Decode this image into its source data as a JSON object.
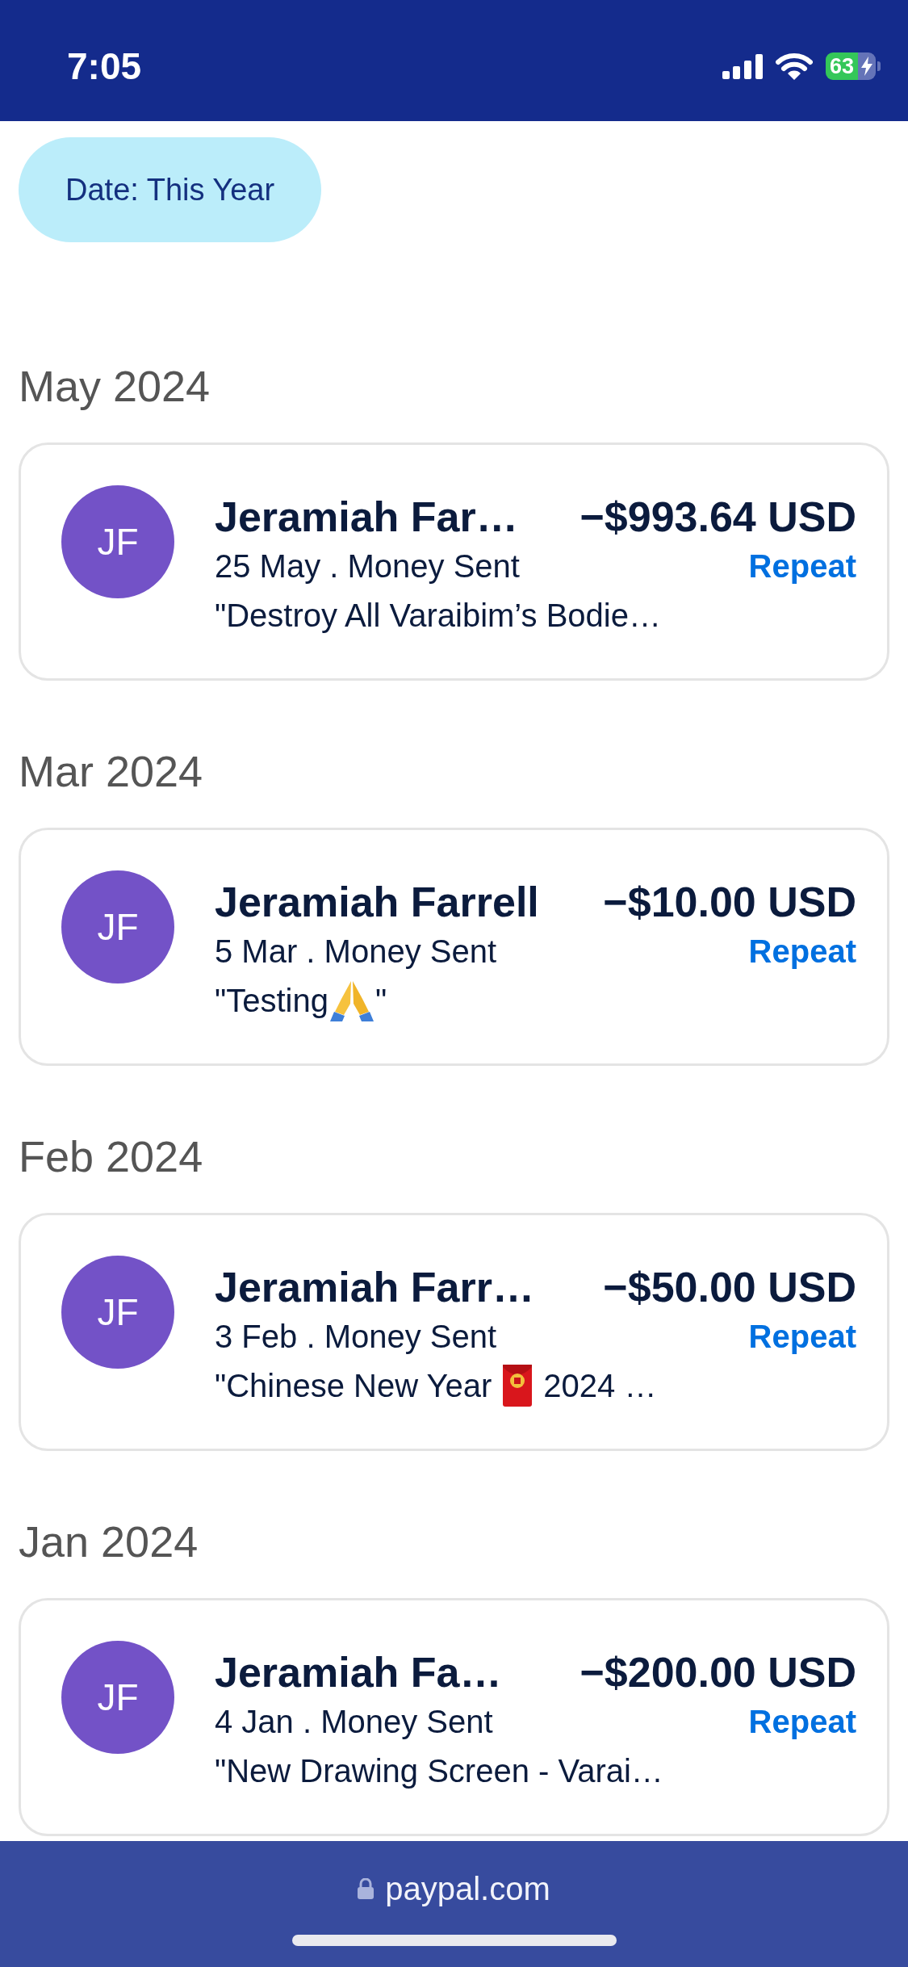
{
  "status_bar": {
    "time": "7:05",
    "battery": "63"
  },
  "filter_chip": {
    "label": "Date: This Year"
  },
  "months": [
    {
      "heading": "May 2024",
      "transaction": {
        "initials": "JF",
        "name": "Jeramiah Far…",
        "amount": "−$993.64 USD",
        "detail": "25 May . Money Sent",
        "action": "Repeat",
        "note": [
          {
            "kind": "text",
            "text": "\"Destroy All Varaibim’s Bodie…"
          }
        ]
      }
    },
    {
      "heading": "Mar 2024",
      "transaction": {
        "initials": "JF",
        "name": "Jeramiah Farrell",
        "amount": "−$10.00 USD",
        "detail": "5 Mar . Money Sent",
        "action": "Repeat",
        "note": [
          {
            "kind": "text",
            "text": "\"Testing"
          },
          {
            "kind": "folded-hands"
          },
          {
            "kind": "text",
            "text": "\""
          }
        ]
      }
    },
    {
      "heading": "Feb 2024",
      "transaction": {
        "initials": "JF",
        "name": "Jeramiah Farr…",
        "amount": "−$50.00 USD",
        "detail": "3 Feb . Money Sent",
        "action": "Repeat",
        "note": [
          {
            "kind": "text",
            "text": "\"Chinese New Year"
          },
          {
            "kind": "envelope"
          },
          {
            "kind": "text",
            "text": "2024 …"
          }
        ]
      }
    },
    {
      "heading": "Jan 2024",
      "transaction": {
        "initials": "JF",
        "name": "Jeramiah Fa…",
        "amount": "−$200.00 USD",
        "detail": "4 Jan . Money Sent",
        "action": "Repeat",
        "note": [
          {
            "kind": "text",
            "text": "\"New Drawing Screen - Varai…"
          }
        ]
      }
    }
  ],
  "address_bar": {
    "url": "paypal.com"
  }
}
